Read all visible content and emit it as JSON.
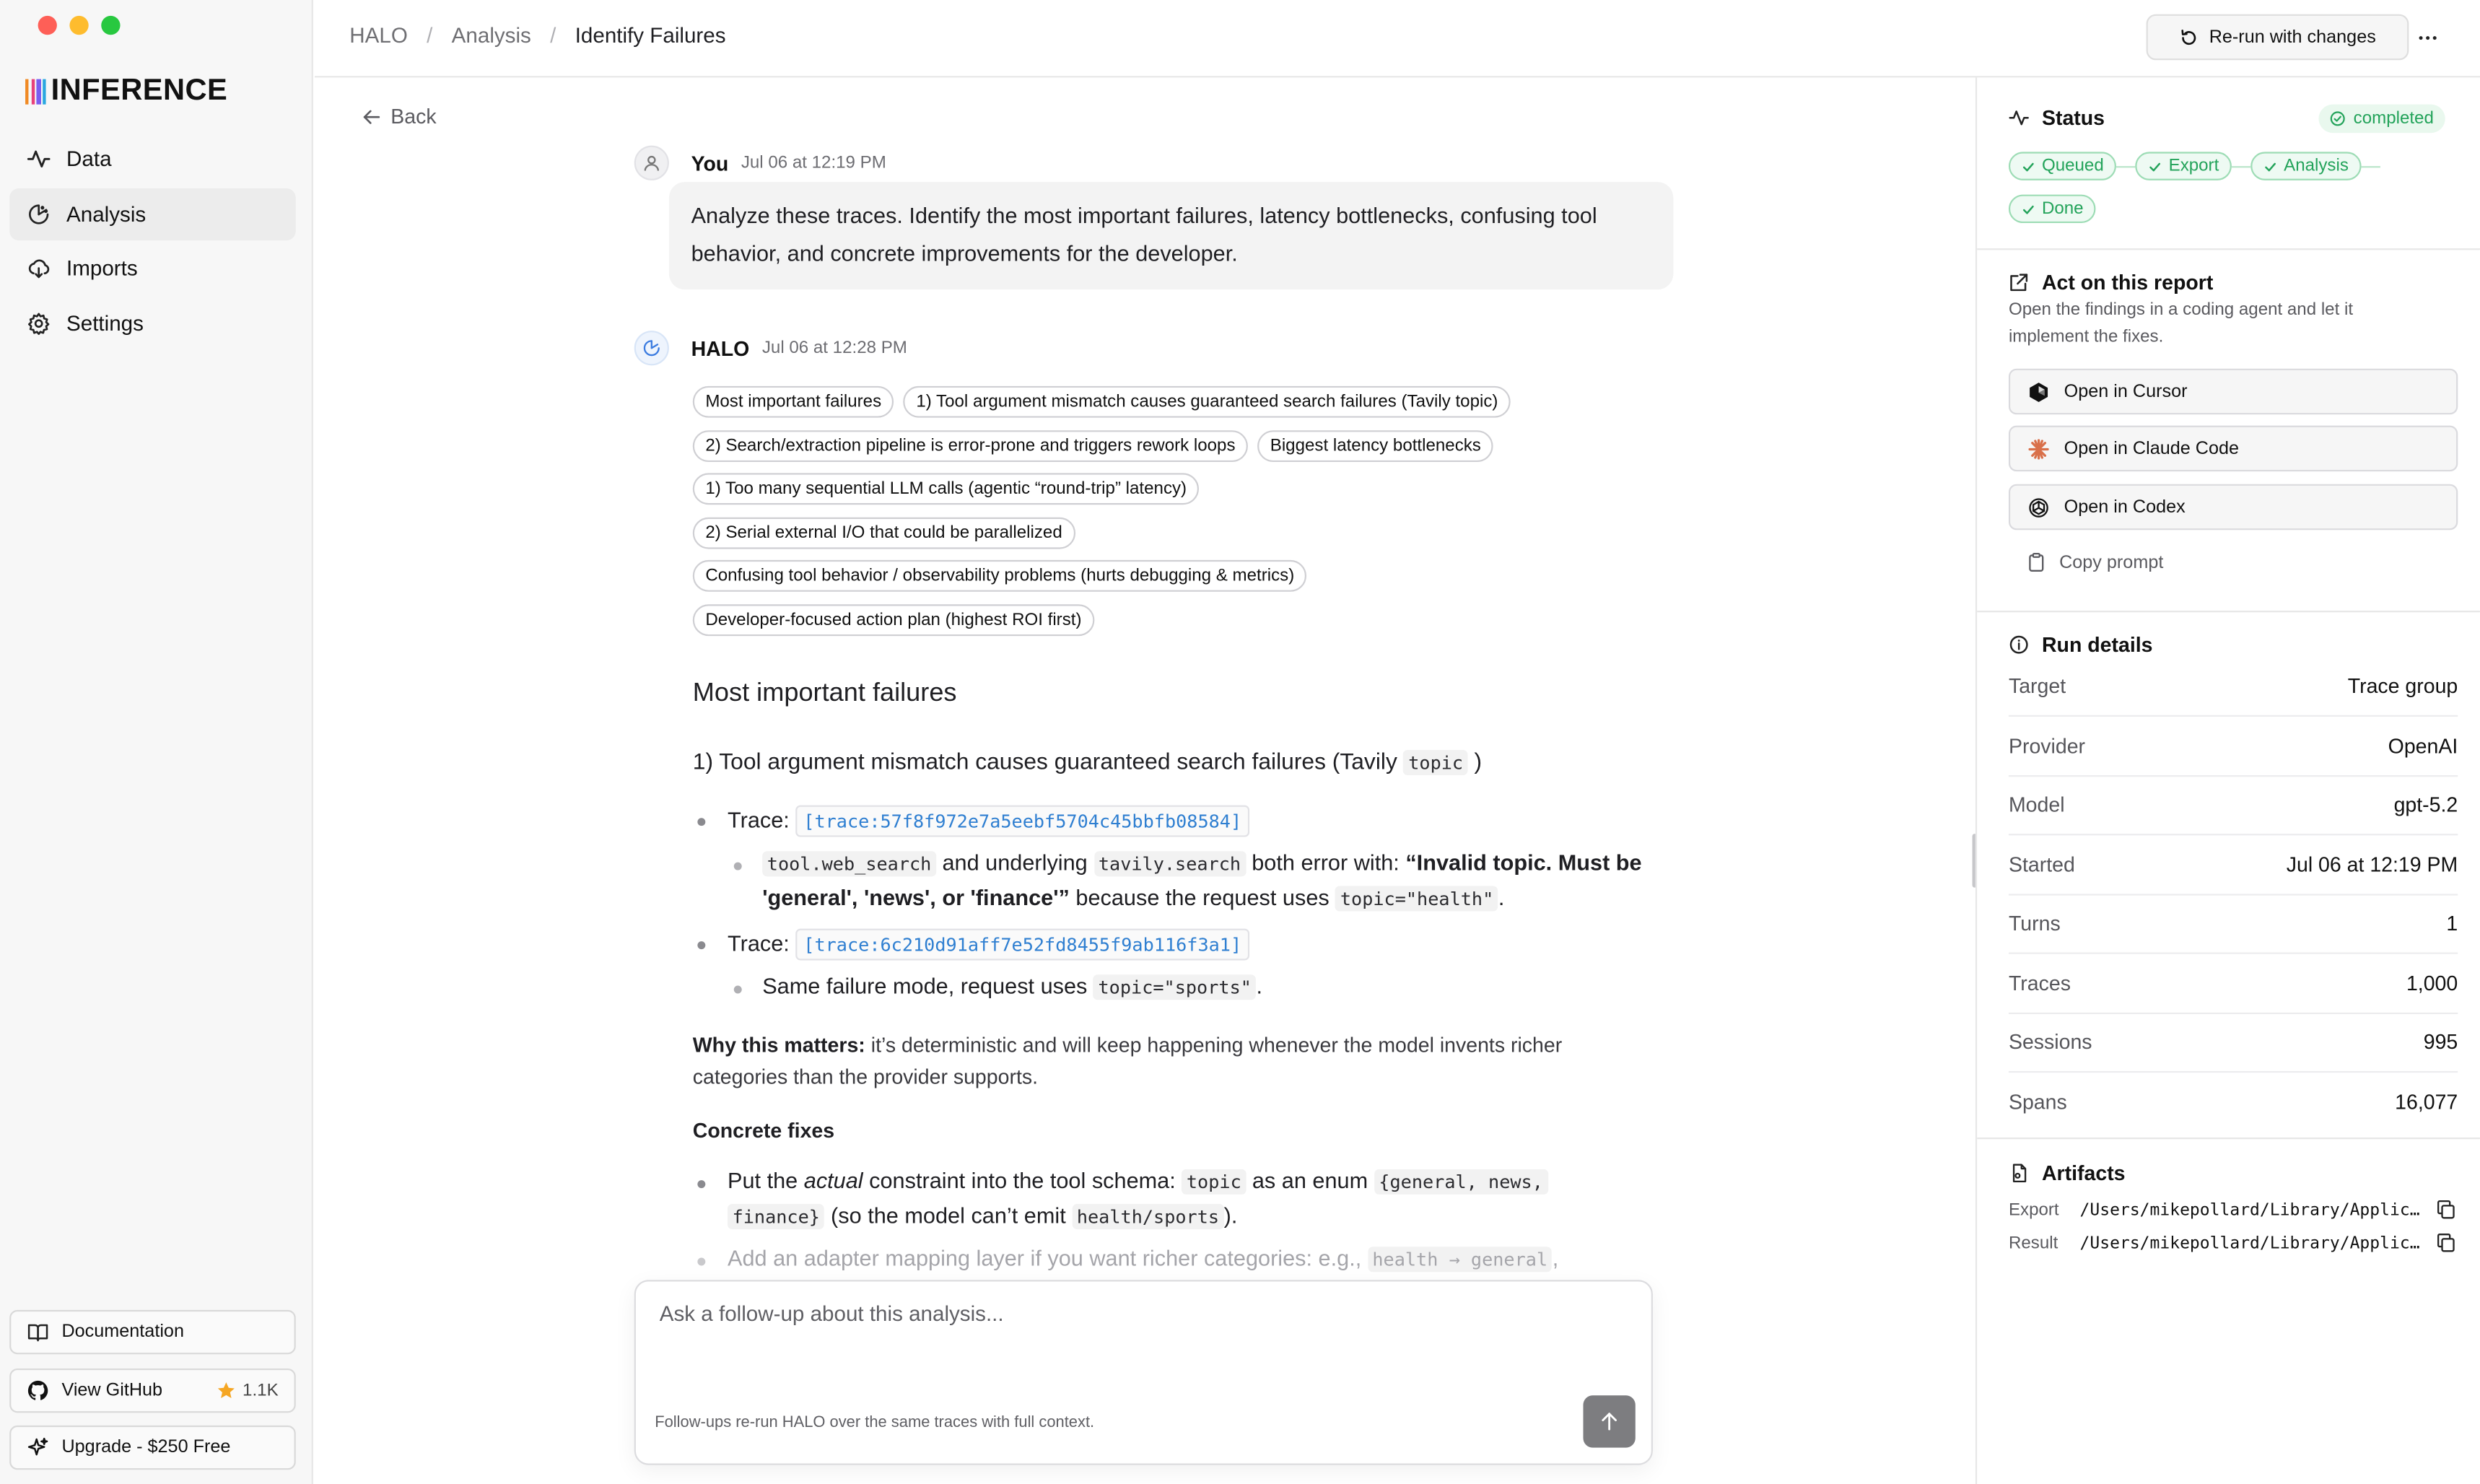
{
  "sidebar": {
    "logo_text": "INFERENCE",
    "nav": [
      {
        "label": "Data",
        "icon": "activity-icon"
      },
      {
        "label": "Analysis",
        "icon": "analysis-icon",
        "active": true
      },
      {
        "label": "Imports",
        "icon": "cloud-download-icon"
      },
      {
        "label": "Settings",
        "icon": "gear-icon"
      }
    ],
    "documentation": "Documentation",
    "github": "View GitHub",
    "github_stars": "1.1K",
    "upgrade": "Upgrade - $250 Free"
  },
  "topbar": {
    "crumb1": "HALO",
    "crumb2": "Analysis",
    "crumb3": "Identify Failures",
    "rerun": "Re-run with changes"
  },
  "main": {
    "back": "Back",
    "user_name": "You",
    "user_time": "Jul 06 at 12:19 PM",
    "user_message": "Analyze these traces. Identify the most important failures, latency bottlenecks, confusing tool behavior, and concrete improvements for the developer.",
    "halo_name": "HALO",
    "halo_time": "Jul 06 at 12:28 PM",
    "chips": [
      "Most important failures",
      "1) Tool argument mismatch causes guaranteed search failures (Tavily topic)",
      "2) Search/extraction pipeline is error-prone and triggers rework loops",
      "Biggest latency bottlenecks",
      "1) Too many sequential LLM calls (agentic “round-trip” latency)",
      "2) Serial external I/O that could be parallelized",
      "Confusing tool behavior / observability problems (hurts debugging & metrics)",
      "Developer-focused action plan (highest ROI first)"
    ],
    "h2": "Most important failures",
    "h3_text": "1) Tool argument mismatch causes guaranteed search failures (Tavily",
    "h3_code": "topic",
    "h3_end": ")",
    "trace_label": "Trace:",
    "trace1": "[trace:57f8f972e7a5eebf5704c45bbfb08584]",
    "trace1_code_a": "tool.web_search",
    "trace1_text_a": "and underlying",
    "trace1_code_b": "tavily.search",
    "trace1_text_b": "both error with:",
    "trace1_bold": "“Invalid topic. Must be",
    "trace1_bold2": "'general', 'news', or 'finance'”",
    "trace1_text_c": "because the request uses",
    "trace1_code_c": "topic=\"health\"",
    "trace2": "[trace:6c210d91aff7e52fd8455f9ab116f3a1]",
    "trace2_text": "Same failure mode, request uses",
    "trace2_code": "topic=\"sports\"",
    "why_bold": "Why this matters:",
    "why_text": "it’s deterministic and will keep happening whenever the model invents richer categories than the provider supports.",
    "fixes_title": "Concrete fixes",
    "fix1_a": "Put the",
    "fix1_em": "actual",
    "fix1_b": "constraint into the tool schema:",
    "fix1_code": "topic",
    "fix1_c": "as an enum",
    "fix1_code2": "{general, news,",
    "fix1_code3": "finance}",
    "fix1_d": "(so the model can’t emit",
    "fix1_code4": "health/sports",
    "fix1_e": ").",
    "fix2_a": "Add an adapter mapping layer if you want richer categories: e.g.,",
    "fix2_code": "health → general",
    "fix2_b": ",",
    "composer_placeholder": "Ask a follow-up about this analysis...",
    "composer_hint": "Follow-ups re-run HALO over the same traces with full context."
  },
  "right": {
    "status_title": "Status",
    "status_badge": "completed",
    "steps": [
      "Queued",
      "Export",
      "Analysis",
      "Done"
    ],
    "act_title": "Act on this report",
    "act_desc": "Open the findings in a coding agent and let it implement the fixes.",
    "open_cursor": "Open in Cursor",
    "open_claude": "Open in Claude Code",
    "open_codex": "Open in Codex",
    "copy_prompt": "Copy prompt",
    "run_title": "Run details",
    "details": [
      {
        "k": "Target",
        "v": "Trace group"
      },
      {
        "k": "Provider",
        "v": "OpenAI"
      },
      {
        "k": "Model",
        "v": "gpt-5.2"
      },
      {
        "k": "Started",
        "v": "Jul 06 at 12:19 PM"
      },
      {
        "k": "Turns",
        "v": "1"
      },
      {
        "k": "Traces",
        "v": "1,000"
      },
      {
        "k": "Sessions",
        "v": "995"
      },
      {
        "k": "Spans",
        "v": "16,077"
      }
    ],
    "artifacts_title": "Artifacts",
    "export_k": "Export",
    "export_v": "/Users/mikepollard/Library/Application Support/Inference/export.json",
    "result_k": "Result",
    "result_v": "/Users/mikepollard/Library/Application Support/Inference/result.md"
  },
  "colors": {
    "accent_green": "#23a35a",
    "link_blue": "#2f7fd1",
    "logo_bars": [
      "#f08a24",
      "#e9417a",
      "#7b5cf0",
      "#2aa7e0"
    ]
  }
}
